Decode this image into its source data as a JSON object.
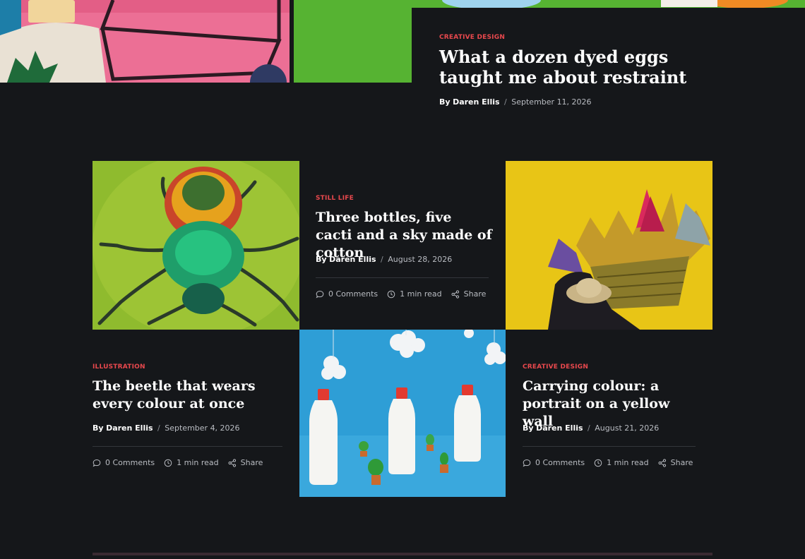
{
  "featured": {
    "category": "Creative Design",
    "title": "What a dozen dyed eggs taught me about restraint",
    "author_prefix": "By",
    "author": "Daren Ellis",
    "separator": "/",
    "date": "September 11, 2026"
  },
  "posts": [
    {
      "category": "Still Life",
      "title": "Three bottles, five cacti and a sky made of cotton",
      "author_prefix": "By",
      "author": "Daren Ellis",
      "separator": "/",
      "date": "August 28, 2026",
      "comments": "0 Comments",
      "read_time": "1 min read",
      "share": "Share"
    },
    {
      "category": "Illustration",
      "title": "The beetle that wears every colour at once",
      "author_prefix": "By",
      "author": "Daren Ellis",
      "separator": "/",
      "date": "September 4, 2026",
      "comments": "0 Comments",
      "read_time": "1 min read",
      "share": "Share"
    },
    {
      "category": "Creative Design",
      "title": "Carrying colour: a portrait on a yellow wall",
      "author_prefix": "By",
      "author": "Daren Ellis",
      "separator": "/",
      "date": "August 21, 2026",
      "comments": "0 Comments",
      "read_time": "1 min read",
      "share": "Share"
    }
  ],
  "icons": {
    "comments": "comment-bubble-icon",
    "read_time": "clock-icon",
    "share": "share-icon"
  },
  "colors": {
    "background": "#15171a",
    "card": "#15171a",
    "category_accent": "#e8484d",
    "text": "#ffffff",
    "muted": "#b9bcc2"
  }
}
